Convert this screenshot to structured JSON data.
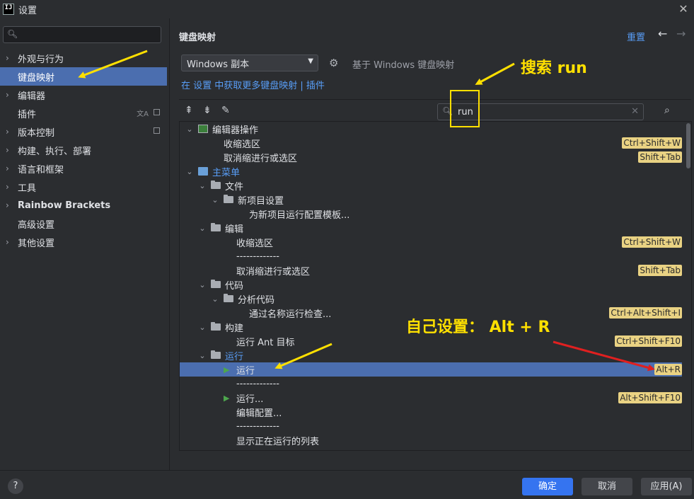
{
  "window": {
    "logo_text": "IJ",
    "title": "设置",
    "close_glyph": "✕"
  },
  "sidebar": {
    "search_placeholder": "",
    "items": [
      {
        "label": "外观与行为",
        "has_arrow": true
      },
      {
        "label": "键盘映射",
        "has_arrow": false,
        "selected": true
      },
      {
        "label": "编辑器",
        "has_arrow": true
      },
      {
        "label": "插件",
        "has_arrow": false
      },
      {
        "label": "版本控制",
        "has_arrow": true
      },
      {
        "label": "构建、执行、部署",
        "has_arrow": true
      },
      {
        "label": "语言和框架",
        "has_arrow": true
      },
      {
        "label": "工具",
        "has_arrow": true
      },
      {
        "label": "Rainbow Brackets",
        "has_arrow": true,
        "bold": true
      },
      {
        "label": "高级设置",
        "has_arrow": false
      },
      {
        "label": "其他设置",
        "has_arrow": true
      }
    ]
  },
  "main": {
    "title": "键盘映射",
    "reset_label": "重置",
    "back_glyph": "←",
    "forward_glyph": "→",
    "keymap_selected": "Windows 副本",
    "based_on": "基于 Windows 键盘映射",
    "links": {
      "part1": "在 设置 中获取更多键盘映射",
      "separator": " | ",
      "part2": "插件"
    },
    "search": {
      "value": "run",
      "placeholder": ""
    }
  },
  "tree": {
    "rows": [
      {
        "indent": 0,
        "expand": "v",
        "icon": "editor",
        "label": "编辑器操作",
        "shortcut": ""
      },
      {
        "indent": 2,
        "expand": "",
        "icon": "",
        "label": "收缩选区",
        "shortcut": "Ctrl+Shift+W"
      },
      {
        "indent": 2,
        "expand": "",
        "icon": "",
        "label": "取消缩进行或选区",
        "shortcut": "Shift+Tab"
      },
      {
        "indent": 0,
        "expand": "v",
        "icon": "menu",
        "label": "主菜单",
        "shortcut": "",
        "blue": true
      },
      {
        "indent": 1,
        "expand": "v",
        "icon": "folder",
        "label": "文件",
        "shortcut": ""
      },
      {
        "indent": 2,
        "expand": "v",
        "icon": "folder",
        "label": "新项目设置",
        "shortcut": ""
      },
      {
        "indent": 4,
        "expand": "",
        "icon": "",
        "label": "为新项目运行配置模板...",
        "shortcut": ""
      },
      {
        "indent": 1,
        "expand": "v",
        "icon": "folder",
        "label": "编辑",
        "shortcut": ""
      },
      {
        "indent": 3,
        "expand": "",
        "icon": "",
        "label": "收缩选区",
        "shortcut": "Ctrl+Shift+W"
      },
      {
        "indent": 3,
        "expand": "",
        "icon": "",
        "label": "-------------",
        "shortcut": ""
      },
      {
        "indent": 3,
        "expand": "",
        "icon": "",
        "label": "取消缩进行或选区",
        "shortcut": "Shift+Tab"
      },
      {
        "indent": 1,
        "expand": "v",
        "icon": "folder",
        "label": "代码",
        "shortcut": ""
      },
      {
        "indent": 2,
        "expand": "v",
        "icon": "folder",
        "label": "分析代码",
        "shortcut": ""
      },
      {
        "indent": 4,
        "expand": "",
        "icon": "",
        "label": "通过名称运行检查...",
        "shortcut": "Ctrl+Alt+Shift+I"
      },
      {
        "indent": 1,
        "expand": "v",
        "icon": "folder",
        "label": "构建",
        "shortcut": ""
      },
      {
        "indent": 3,
        "expand": "",
        "icon": "",
        "label": "运行 Ant 目标",
        "shortcut": "Ctrl+Shift+F10"
      },
      {
        "indent": 1,
        "expand": "v",
        "icon": "folder",
        "label": "运行",
        "shortcut": "",
        "blue": true
      },
      {
        "indent": 3,
        "expand": "",
        "icon": "play",
        "label": "运行",
        "shortcut": "Alt+R",
        "selected": true
      },
      {
        "indent": 3,
        "expand": "",
        "icon": "",
        "label": "-------------",
        "shortcut": ""
      },
      {
        "indent": 3,
        "expand": "",
        "icon": "play",
        "label": "运行...",
        "shortcut": "Alt+Shift+F10"
      },
      {
        "indent": 3,
        "expand": "",
        "icon": "",
        "label": "编辑配置...",
        "shortcut": ""
      },
      {
        "indent": 3,
        "expand": "",
        "icon": "",
        "label": "-------------",
        "shortcut": ""
      },
      {
        "indent": 3,
        "expand": "",
        "icon": "",
        "label": "显示正在运行的列表",
        "shortcut": ""
      }
    ]
  },
  "footer": {
    "help_label": "?",
    "ok_label": "确定",
    "cancel_label": "取消",
    "apply_label": "应用(A)"
  },
  "annotations": {
    "search_note": "搜索 run",
    "custom_note": "自己设置：  Alt + R",
    "color_yellow": "#ffe000",
    "color_red": "#e02020"
  }
}
